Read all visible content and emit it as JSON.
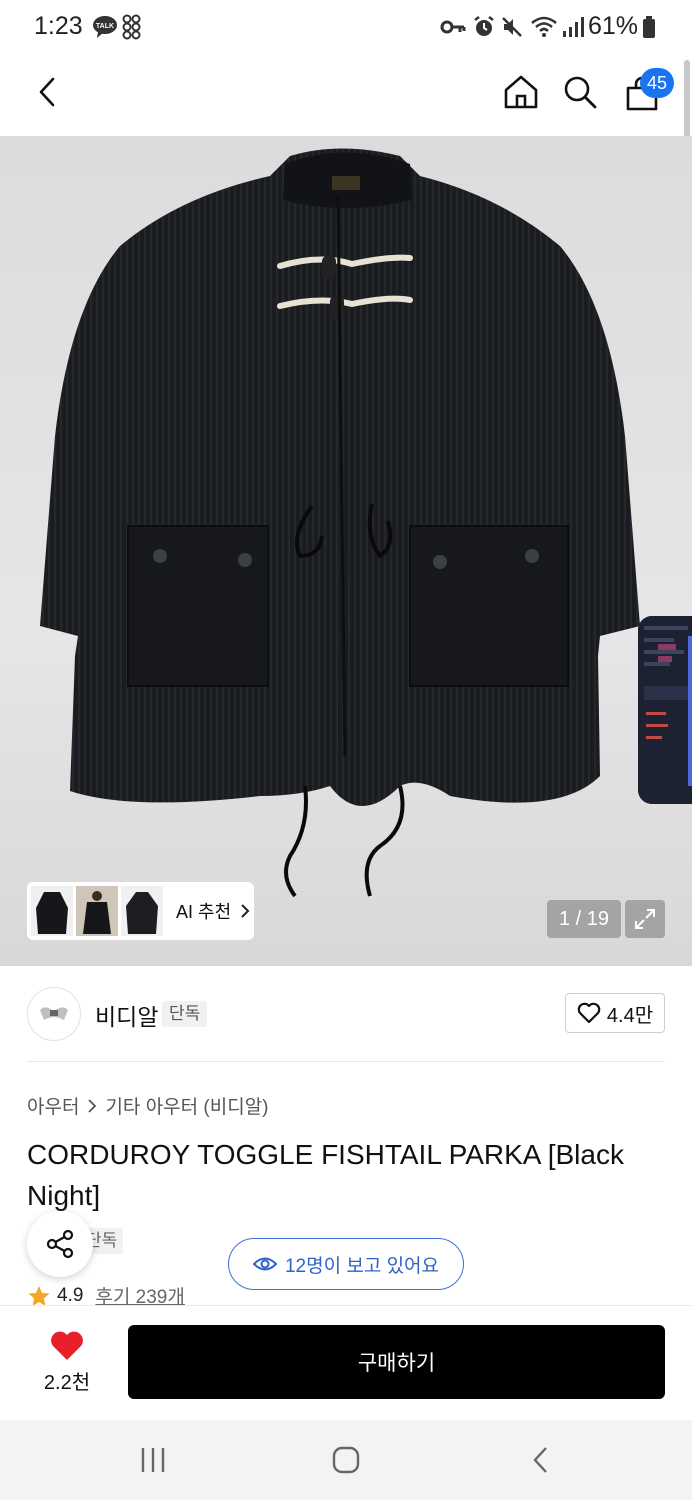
{
  "status_bar": {
    "time": "1:23",
    "battery": "61%",
    "icons": [
      "talk-icon",
      "app-grid-icon",
      "key-icon",
      "alarm-icon",
      "mute-icon",
      "wifi-icon",
      "signal-icon",
      "battery-icon"
    ],
    "talk_label": "TALK"
  },
  "header": {
    "back": "back-icon",
    "home": "home-icon",
    "search": "search-icon",
    "cart": "cart-icon",
    "cart_count": "45"
  },
  "gallery": {
    "counter": "1 / 19",
    "ai_label": "AI 추천",
    "ai_thumbnails": 3
  },
  "brand": {
    "name": "비디알",
    "exclusive": "단독",
    "likes": "4.4만"
  },
  "product": {
    "breadcrumb": [
      "아우터",
      "기타 아우터 (비디알)"
    ],
    "title": "CORDUROY TOGGLE FISHTAIL PARKA [Black Night]",
    "exclusive": "단독",
    "rating": "4.9",
    "reviews": "후기 239개",
    "viewers": "12명이 보고 있어요"
  },
  "bottom": {
    "heart_count": "2.2천",
    "buy_label": "구매하기"
  },
  "colors": {
    "accent_blue": "#1a73f0",
    "viewer_blue": "#2f63c9",
    "heart_red": "#e8202a",
    "star": "#f5a623",
    "buy_bg": "#000000"
  }
}
